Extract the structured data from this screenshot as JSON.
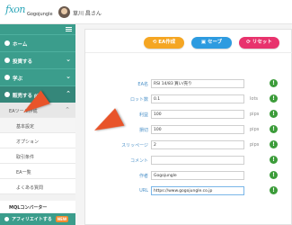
{
  "header": {
    "logo_text": "Gogojungle",
    "username": "草川 昌さん"
  },
  "sidebar": {
    "home": "ホーム",
    "invest": "投資する",
    "learn": "学ぶ",
    "sell": "販売する",
    "sell_badge": "β版",
    "ea_section": "EAツール作成",
    "sub_items": [
      "基本設定",
      "オプション",
      "取引条件",
      "EA一覧",
      "よくある質問"
    ],
    "mql": "MQLコンバーター",
    "affiliate": "アフィリエイトする",
    "affiliate_badge": "NEW"
  },
  "toolbar": {
    "ea_create": "EA作成",
    "save": "セーブ",
    "reset": "リセット"
  },
  "form": {
    "rows": [
      {
        "label": "EA名",
        "value": "RSI 14/83 買い/売り",
        "unit": ""
      },
      {
        "label": "ロット数",
        "value": "0.1",
        "unit": "lots"
      },
      {
        "label": "利益",
        "value": "100",
        "unit": "pips"
      },
      {
        "label": "損切",
        "value": "100",
        "unit": "pips"
      },
      {
        "label": "スリッページ",
        "value": "2",
        "unit": "pips"
      },
      {
        "label": "コメント",
        "value": "",
        "unit": ""
      },
      {
        "label": "作者",
        "value": "Gogojungle",
        "unit": ""
      },
      {
        "label": "URL",
        "value": "https://www.gogojungle.co.jp",
        "unit": ""
      }
    ],
    "alert_glyph": "!"
  },
  "colors": {
    "sidebar_green": "#3b9d8c",
    "btn_ea": "#f5a623",
    "btn_save": "#2d9be0",
    "btn_reset": "#e8336d",
    "label_blue": "#4a90c8",
    "alert_green": "#3c9c3a",
    "arrow_red": "#e8542a"
  }
}
